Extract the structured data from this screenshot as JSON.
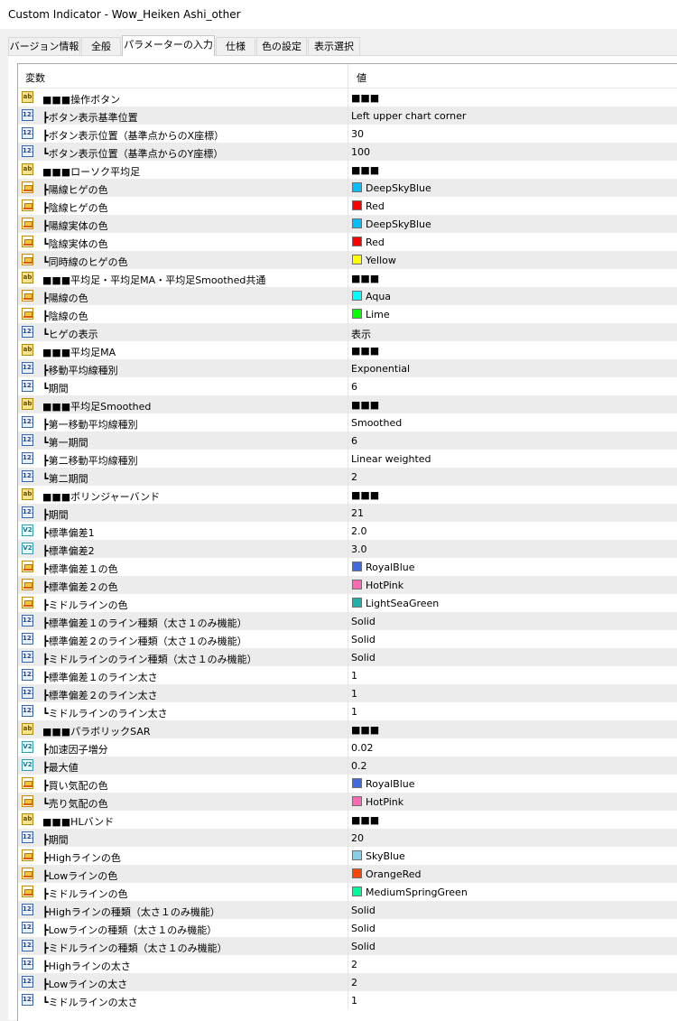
{
  "window": {
    "title": "Custom Indicator - Wow_Heiken Ashi_other"
  },
  "tabs": [
    {
      "label": "バージョン情報",
      "active": false
    },
    {
      "label": "全般",
      "active": false
    },
    {
      "label": "パラメーターの入力",
      "active": true
    },
    {
      "label": "仕様",
      "active": false
    },
    {
      "label": "色の設定",
      "active": false
    },
    {
      "label": "表示選択",
      "active": false
    }
  ],
  "table": {
    "headers": {
      "variable": "変数",
      "value": "値"
    },
    "rows": [
      {
        "icon": "str",
        "name": "■■■操作ボタン",
        "value": "■■■"
      },
      {
        "icon": "int",
        "name": "┣ボタン表示基準位置",
        "value": "Left upper chart corner"
      },
      {
        "icon": "int",
        "name": "┣ボタン表示位置（基準点からのX座標）",
        "value": "30"
      },
      {
        "icon": "int",
        "name": "┗ボタン表示位置（基準点からのY座標）",
        "value": "100"
      },
      {
        "icon": "str",
        "name": "■■■ローソク平均足",
        "value": "■■■"
      },
      {
        "icon": "color",
        "name": "┣陽線ヒゲの色",
        "value": "DeepSkyBlue",
        "swatch": "#00bfff"
      },
      {
        "icon": "color",
        "name": "┣陰線ヒゲの色",
        "value": "Red",
        "swatch": "#ff0000"
      },
      {
        "icon": "color",
        "name": "┣陽線実体の色",
        "value": "DeepSkyBlue",
        "swatch": "#00bfff"
      },
      {
        "icon": "color",
        "name": "┗陰線実体の色",
        "value": "Red",
        "swatch": "#ff0000"
      },
      {
        "icon": "color",
        "name": "┗同時線のヒゲの色",
        "value": "Yellow",
        "swatch": "#ffff00"
      },
      {
        "icon": "str",
        "name": "■■■平均足・平均足MA・平均足Smoothed共通",
        "value": "■■■"
      },
      {
        "icon": "color",
        "name": "┣陽線の色",
        "value": "Aqua",
        "swatch": "#00ffff"
      },
      {
        "icon": "color",
        "name": "┣陰線の色",
        "value": "Lime",
        "swatch": "#00ff00"
      },
      {
        "icon": "int",
        "name": "┗ヒゲの表示",
        "value": "表示"
      },
      {
        "icon": "str",
        "name": "■■■平均足MA",
        "value": "■■■"
      },
      {
        "icon": "int",
        "name": "┣移動平均線種別",
        "value": "Exponential"
      },
      {
        "icon": "int",
        "name": "┗期間",
        "value": "6"
      },
      {
        "icon": "str",
        "name": "■■■平均足Smoothed",
        "value": "■■■"
      },
      {
        "icon": "int",
        "name": "┣第一移動平均線種別",
        "value": "Smoothed"
      },
      {
        "icon": "int",
        "name": "┗第一期間",
        "value": "6"
      },
      {
        "icon": "int",
        "name": "┣第二移動平均線種別",
        "value": "Linear weighted"
      },
      {
        "icon": "int",
        "name": "┗第二期間",
        "value": "2"
      },
      {
        "icon": "str",
        "name": "■■■ボリンジャーバンド",
        "value": "■■■"
      },
      {
        "icon": "int",
        "name": "┣期間",
        "value": "21"
      },
      {
        "icon": "double",
        "name": "┣標準偏差1",
        "value": "2.0"
      },
      {
        "icon": "double",
        "name": "┣標準偏差2",
        "value": "3.0"
      },
      {
        "icon": "color",
        "name": "┣標準偏差１の色",
        "value": "RoyalBlue",
        "swatch": "#4169e1"
      },
      {
        "icon": "color",
        "name": "┣標準偏差２の色",
        "value": "HotPink",
        "swatch": "#ff69b4"
      },
      {
        "icon": "color",
        "name": "┣ミドルラインの色",
        "value": "LightSeaGreen",
        "swatch": "#20b2aa"
      },
      {
        "icon": "int",
        "name": "┣標準偏差１のライン種類（太さ１のみ機能）",
        "value": "Solid"
      },
      {
        "icon": "int",
        "name": "┣標準偏差２のライン種類（太さ１のみ機能）",
        "value": "Solid"
      },
      {
        "icon": "int",
        "name": "┣ミドルラインのライン種類（太さ１のみ機能）",
        "value": "Solid"
      },
      {
        "icon": "int",
        "name": "┣標準偏差１のライン太さ",
        "value": "1"
      },
      {
        "icon": "int",
        "name": "┣標準偏差２のライン太さ",
        "value": "1"
      },
      {
        "icon": "int",
        "name": "┗ミドルラインのライン太さ",
        "value": "1"
      },
      {
        "icon": "str",
        "name": "■■■パラボリックSAR",
        "value": "■■■"
      },
      {
        "icon": "double",
        "name": "┣加速因子増分",
        "value": "0.02"
      },
      {
        "icon": "double",
        "name": "┣最大値",
        "value": "0.2"
      },
      {
        "icon": "color",
        "name": "┣買い気配の色",
        "value": "RoyalBlue",
        "swatch": "#4169e1"
      },
      {
        "icon": "color",
        "name": "┗売り気配の色",
        "value": "HotPink",
        "swatch": "#ff69b4"
      },
      {
        "icon": "str",
        "name": "■■■HLバンド",
        "value": "■■■"
      },
      {
        "icon": "int",
        "name": "┣期間",
        "value": "20"
      },
      {
        "icon": "color",
        "name": "┣Highラインの色",
        "value": "SkyBlue",
        "swatch": "#87ceeb"
      },
      {
        "icon": "color",
        "name": "┣Lowラインの色",
        "value": "OrangeRed",
        "swatch": "#ff4500"
      },
      {
        "icon": "color",
        "name": "┣ミドルラインの色",
        "value": "MediumSpringGreen",
        "swatch": "#00fa9a"
      },
      {
        "icon": "int",
        "name": "┣Highラインの種類（太さ１のみ機能）",
        "value": "Solid"
      },
      {
        "icon": "int",
        "name": "┣Lowラインの種類（太さ１のみ機能）",
        "value": "Solid"
      },
      {
        "icon": "int",
        "name": "┣ミドルラインの種類（太さ１のみ機能）",
        "value": "Solid"
      },
      {
        "icon": "int",
        "name": "┣Highラインの太さ",
        "value": "2"
      },
      {
        "icon": "int",
        "name": "┣Lowラインの太さ",
        "value": "2"
      },
      {
        "icon": "int",
        "name": "┗ミドルラインの太さ",
        "value": "1"
      }
    ]
  },
  "icons": {
    "str": {
      "name": "string-type-icon",
      "glyph": "ab"
    },
    "int": {
      "name": "integer-type-icon",
      "glyph": "123"
    },
    "double": {
      "name": "double-type-icon",
      "glyph": "V2"
    },
    "color": {
      "name": "color-type-icon",
      "glyph": ""
    }
  }
}
